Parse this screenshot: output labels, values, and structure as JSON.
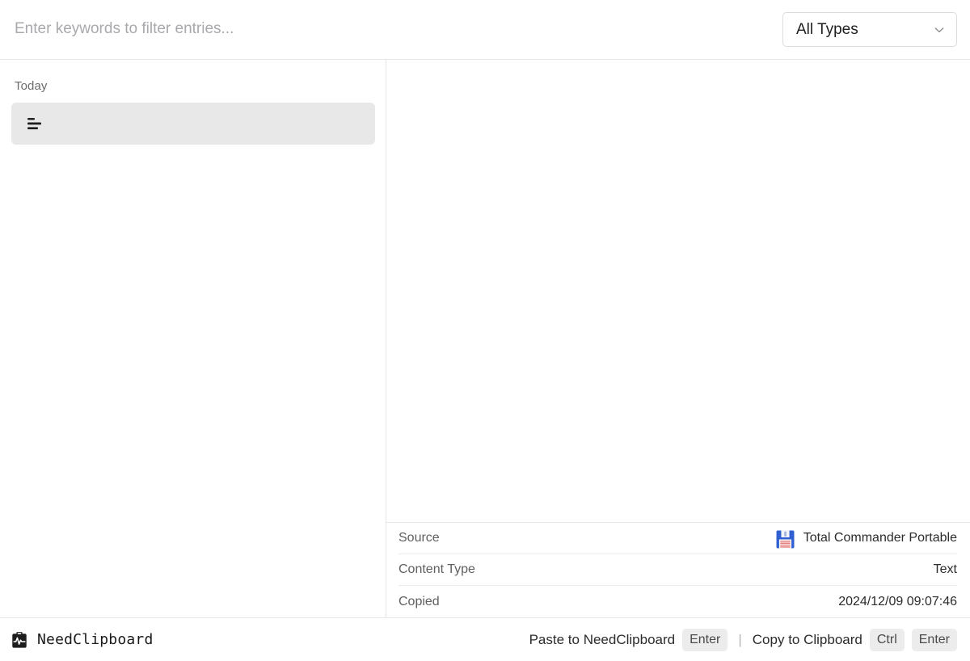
{
  "header": {
    "search": {
      "placeholder": "Enter keywords to filter entries...",
      "value": ""
    },
    "type_filter": {
      "selected": "All Types",
      "options": [
        "All Types"
      ],
      "icon": "chevron-down-icon"
    }
  },
  "list_pane": {
    "groups": [
      {
        "label": "Today",
        "items": [
          {
            "icon": "text-lines-icon",
            "text": "",
            "selected": true
          }
        ]
      }
    ]
  },
  "detail_pane": {
    "preview": {
      "content": ""
    },
    "metadata": [
      {
        "key": "Source",
        "value": "Total Commander Portable",
        "icon": "floppy-disk-icon"
      },
      {
        "key": "Content Type",
        "value": "Text",
        "icon": ""
      },
      {
        "key": "Copied",
        "value": "2024/12/09 09:07:46",
        "icon": ""
      }
    ]
  },
  "statusbar": {
    "brand": {
      "icon": "clipboard-pulse-icon",
      "name": "NeedClipboard"
    },
    "hints": [
      {
        "label": "Paste to NeedClipboard",
        "keys": [
          "Enter"
        ]
      },
      {
        "label": "Copy to Clipboard",
        "keys": [
          "Ctrl",
          "Enter"
        ]
      }
    ],
    "separator": "|"
  },
  "colors": {
    "accent_selected": "#e8e8e8",
    "border": "#e6e6e6",
    "text_primary": "#1f1f1f",
    "text_muted": "#6b6b6b",
    "placeholder": "#a9a9ad",
    "key_badge": "#ececec",
    "floppy_blue": "#2f5fd0",
    "floppy_red": "#e06464"
  }
}
